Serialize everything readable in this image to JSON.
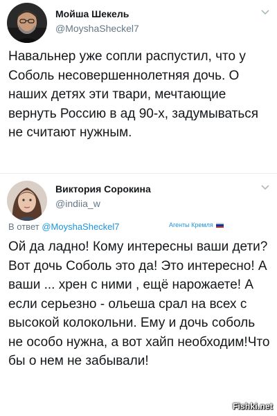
{
  "tweets": [
    {
      "display_name": "Мойша Шекель",
      "handle": "@MoyshaSheckel7",
      "text": "Навальнер уже сопли распустил, что у Соболь несовершеннолетняя дочь. О наших детях эти твари, мечтающие вернуть Россию в ад 90-х, задумываться не считают нужным.",
      "menu_icon": "chevron-down-icon"
    },
    {
      "display_name": "Виктория Сорокина",
      "handle": "@indiia_w",
      "reply_prefix": "В ответ",
      "reply_handle": "@MoyshaSheckel7",
      "label": "Агенты Кремля",
      "text": "Ой да ладно! Кому интересны ваши дети?Вот дочь Соболь это да! Это интересно! А ваши ... хрен с ними , ещё нарожаете!  А если серьезно - ольеша срал на всех с высокой колокольни. Ему и дочь соболь не особо нужна, а вот хайп необходим!Что бы о нем не забывали!",
      "menu_icon": "chevron-down-icon"
    }
  ],
  "watermark": "Fishki.net",
  "colors": {
    "link": "#1b95e0",
    "secondary_text": "#657786",
    "primary_text": "#14171a",
    "flag": [
      "#ffffff",
      "#0039a6",
      "#d52b1e"
    ]
  }
}
